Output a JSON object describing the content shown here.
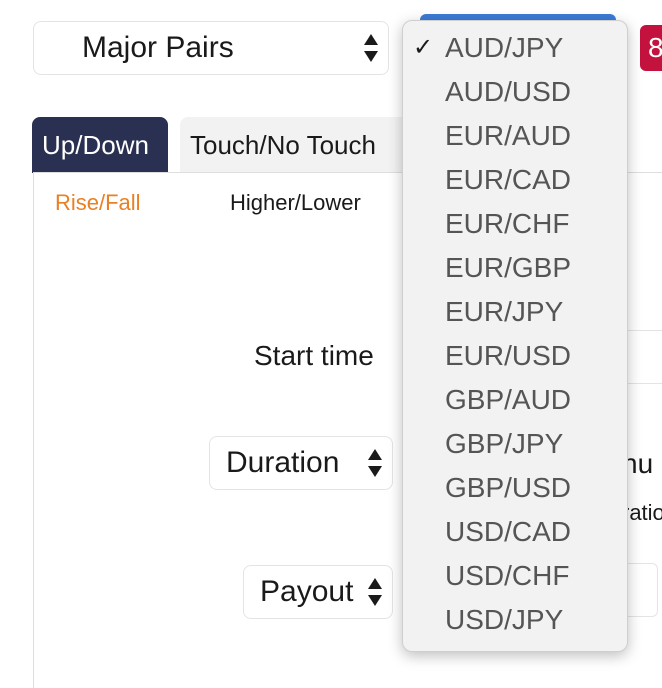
{
  "market_select": {
    "label": "Major Pairs"
  },
  "badge": {
    "text": "8"
  },
  "tabs": [
    {
      "label": "Up/Down",
      "active": true
    },
    {
      "label": "Touch/No Touch",
      "active": false
    }
  ],
  "subtabs": [
    {
      "label": "Rise/Fall",
      "active": true
    },
    {
      "label": "Higher/Lower",
      "active": false
    }
  ],
  "form": {
    "start_time_label": "Start time",
    "duration_label": "Duration",
    "duration_unit_partial": "nu",
    "duration_hint_partial": "ratio",
    "payout_label": "Payout"
  },
  "dropdown": {
    "selected": "AUD/JPY",
    "check_glyph": "✓",
    "options": [
      "AUD/JPY",
      "AUD/USD",
      "EUR/AUD",
      "EUR/CAD",
      "EUR/CHF",
      "EUR/GBP",
      "EUR/JPY",
      "EUR/USD",
      "GBP/AUD",
      "GBP/JPY",
      "GBP/USD",
      "USD/CAD",
      "USD/CHF",
      "USD/JPY"
    ]
  },
  "colors": {
    "active_tab_bg": "#2a3052",
    "active_subtab": "#e98024",
    "badge_bg": "#c4123e",
    "top_select_bg": "#3c7bd6"
  },
  "icons": {
    "select_arrows": "up-down-arrows-icon",
    "check": "checkmark-icon"
  }
}
